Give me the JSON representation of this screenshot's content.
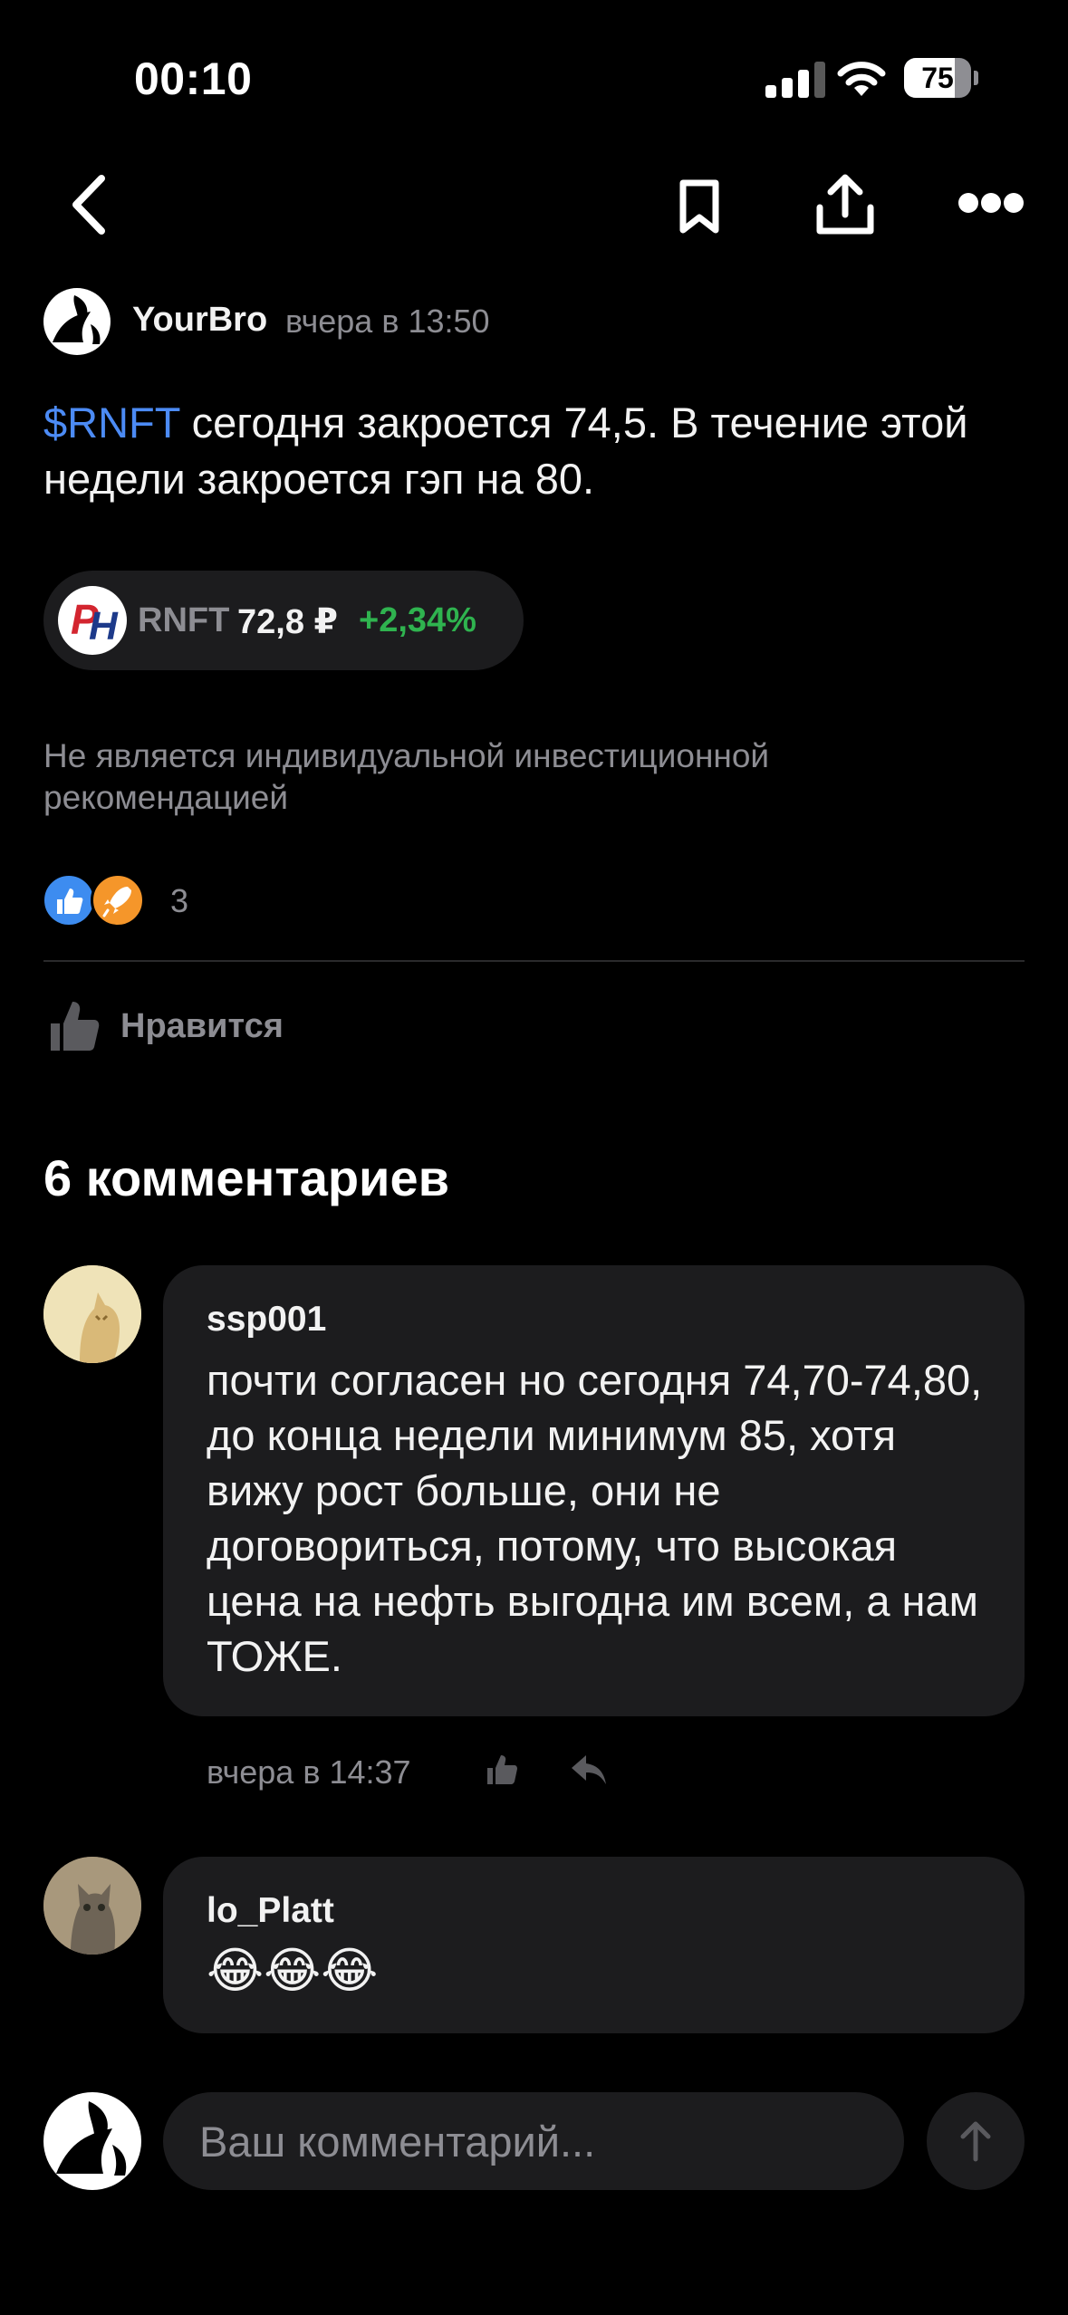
{
  "status_bar": {
    "time": "00:10",
    "battery": "75",
    "battery_level": 0.75
  },
  "post": {
    "author": "YourBro",
    "time": "вчера в 13:50",
    "ticker": "$RNFT",
    "text": " сегодня закроется 74,5. В течение этой недели закроется гэп на 80.",
    "chip": {
      "ticker": "RNFT",
      "price": "72,8 ₽",
      "change": "+2,34%"
    },
    "disclaimer": "Не является индивидуальной инвестиционной рекомендацией",
    "reactions_count": "3",
    "like_label": "Нравится"
  },
  "comments": {
    "title": "6 комментариев",
    "items": [
      {
        "author": "ssp001",
        "text": "почти согласен но сегодня 74,70-74,80, до конца недели минимум 85, хотя вижу рост больше, они не договориться, потому, что высокая цена на нефть выгодна им всем, а нам ТОЖЕ.",
        "time": "вчера в 14:37"
      },
      {
        "author": "lo_Platt",
        "text": "😂😂😂"
      }
    ]
  },
  "composer": {
    "placeholder": "Ваш комментарий..."
  },
  "colors": {
    "accent": "#4c8bf5",
    "positive": "#2fb34f",
    "muted": "#8d8d93",
    "surface": "#1c1c1e"
  }
}
